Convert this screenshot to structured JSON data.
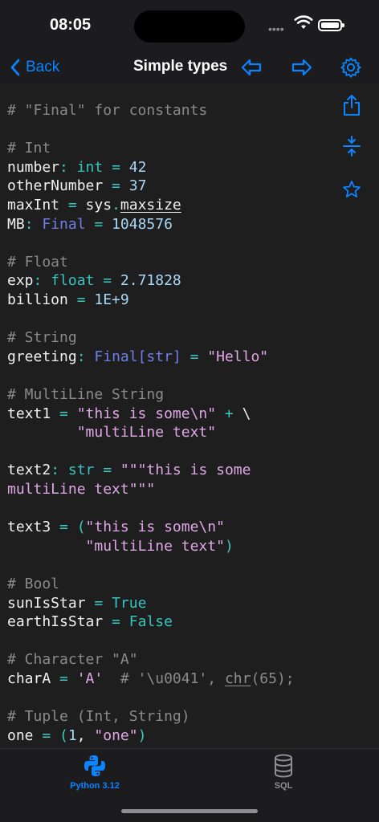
{
  "status_bar": {
    "time": "08:05",
    "signal_glyph": "••••"
  },
  "nav": {
    "back_label": "Back",
    "title": "Simple types",
    "icons": [
      "arrow-left-icon",
      "arrow-right-icon",
      "gear-icon"
    ],
    "accent_color": "#0a84ff"
  },
  "side_actions": [
    "share-icon",
    "collapse-icon",
    "star-icon"
  ],
  "code": {
    "lines": [
      [
        {
          "t": "# \"Final\" for constants",
          "c": "com"
        }
      ],
      [],
      [
        {
          "t": "# Int",
          "c": "com"
        }
      ],
      [
        {
          "t": "number",
          "c": "id"
        },
        {
          "t": ": ",
          "c": "op"
        },
        {
          "t": "int",
          "c": "kw"
        },
        {
          "t": " = ",
          "c": "op"
        },
        {
          "t": "42",
          "c": "num"
        }
      ],
      [
        {
          "t": "otherNumber",
          "c": "id"
        },
        {
          "t": " = ",
          "c": "op"
        },
        {
          "t": "37",
          "c": "num"
        }
      ],
      [
        {
          "t": "maxInt",
          "c": "id"
        },
        {
          "t": " = ",
          "c": "op"
        },
        {
          "t": "sys",
          "c": "id"
        },
        {
          "t": ".",
          "c": "op"
        },
        {
          "t": "maxsize",
          "c": "id",
          "u": true
        }
      ],
      [
        {
          "t": "MB",
          "c": "id"
        },
        {
          "t": ": ",
          "c": "op"
        },
        {
          "t": "Final",
          "c": "type"
        },
        {
          "t": " = ",
          "c": "op"
        },
        {
          "t": "1048576",
          "c": "num"
        }
      ],
      [],
      [
        {
          "t": "# Float",
          "c": "com"
        }
      ],
      [
        {
          "t": "exp",
          "c": "id"
        },
        {
          "t": ": ",
          "c": "op"
        },
        {
          "t": "float",
          "c": "kw"
        },
        {
          "t": " = ",
          "c": "op"
        },
        {
          "t": "2.71828",
          "c": "num"
        }
      ],
      [
        {
          "t": "billion",
          "c": "id"
        },
        {
          "t": " = ",
          "c": "op"
        },
        {
          "t": "1E+9",
          "c": "num"
        }
      ],
      [],
      [
        {
          "t": "# String",
          "c": "com"
        }
      ],
      [
        {
          "t": "greeting",
          "c": "id"
        },
        {
          "t": ": ",
          "c": "op"
        },
        {
          "t": "Final[str]",
          "c": "type"
        },
        {
          "t": " = ",
          "c": "op"
        },
        {
          "t": "\"Hello\"",
          "c": "str"
        }
      ],
      [],
      [
        {
          "t": "# MultiLine String",
          "c": "com"
        }
      ],
      [
        {
          "t": "text1",
          "c": "id"
        },
        {
          "t": " = ",
          "c": "op"
        },
        {
          "t": "\"this is some\\n\"",
          "c": "str"
        },
        {
          "t": " + ",
          "c": "op"
        },
        {
          "t": "\\",
          "c": "id"
        }
      ],
      [
        {
          "t": "        ",
          "c": "id"
        },
        {
          "t": "\"multiLine text\"",
          "c": "str"
        }
      ],
      [],
      [
        {
          "t": "text2",
          "c": "id"
        },
        {
          "t": ": ",
          "c": "op"
        },
        {
          "t": "str",
          "c": "kw"
        },
        {
          "t": " = ",
          "c": "op"
        },
        {
          "t": "\"\"\"this is some",
          "c": "str"
        }
      ],
      [
        {
          "t": "multiLine text\"\"\"",
          "c": "str"
        }
      ],
      [],
      [
        {
          "t": "text3",
          "c": "id"
        },
        {
          "t": " = ",
          "c": "op"
        },
        {
          "t": "(",
          "c": "op"
        },
        {
          "t": "\"this is some\\n\"",
          "c": "str"
        }
      ],
      [
        {
          "t": "         ",
          "c": "id"
        },
        {
          "t": "\"multiLine text\"",
          "c": "str"
        },
        {
          "t": ")",
          "c": "op"
        }
      ],
      [],
      [
        {
          "t": "# Bool",
          "c": "com"
        }
      ],
      [
        {
          "t": "sunIsStar",
          "c": "id"
        },
        {
          "t": " = ",
          "c": "op"
        },
        {
          "t": "True",
          "c": "kw"
        }
      ],
      [
        {
          "t": "earthIsStar",
          "c": "id"
        },
        {
          "t": " = ",
          "c": "op"
        },
        {
          "t": "False",
          "c": "kw"
        }
      ],
      [],
      [
        {
          "t": "# Character \"A\"",
          "c": "com"
        }
      ],
      [
        {
          "t": "charA",
          "c": "id"
        },
        {
          "t": " = ",
          "c": "op"
        },
        {
          "t": "'A'",
          "c": "str"
        },
        {
          "t": "  # '\\u0041', ",
          "c": "com"
        },
        {
          "t": "chr",
          "c": "fn"
        },
        {
          "t": "(65);",
          "c": "com"
        }
      ],
      [],
      [
        {
          "t": "# Tuple (Int, String)",
          "c": "com"
        }
      ],
      [
        {
          "t": "one",
          "c": "id"
        },
        {
          "t": " = ",
          "c": "op"
        },
        {
          "t": "(",
          "c": "op"
        },
        {
          "t": "1",
          "c": "num"
        },
        {
          "t": ", ",
          "c": "id"
        },
        {
          "t": "\"one\"",
          "c": "str"
        },
        {
          "t": ")",
          "c": "op"
        }
      ]
    ]
  },
  "tabs": [
    {
      "label": "Python 3.12",
      "icon": "python-icon",
      "selected": true
    },
    {
      "label": "SQL",
      "icon": "database-icon",
      "selected": false
    }
  ]
}
